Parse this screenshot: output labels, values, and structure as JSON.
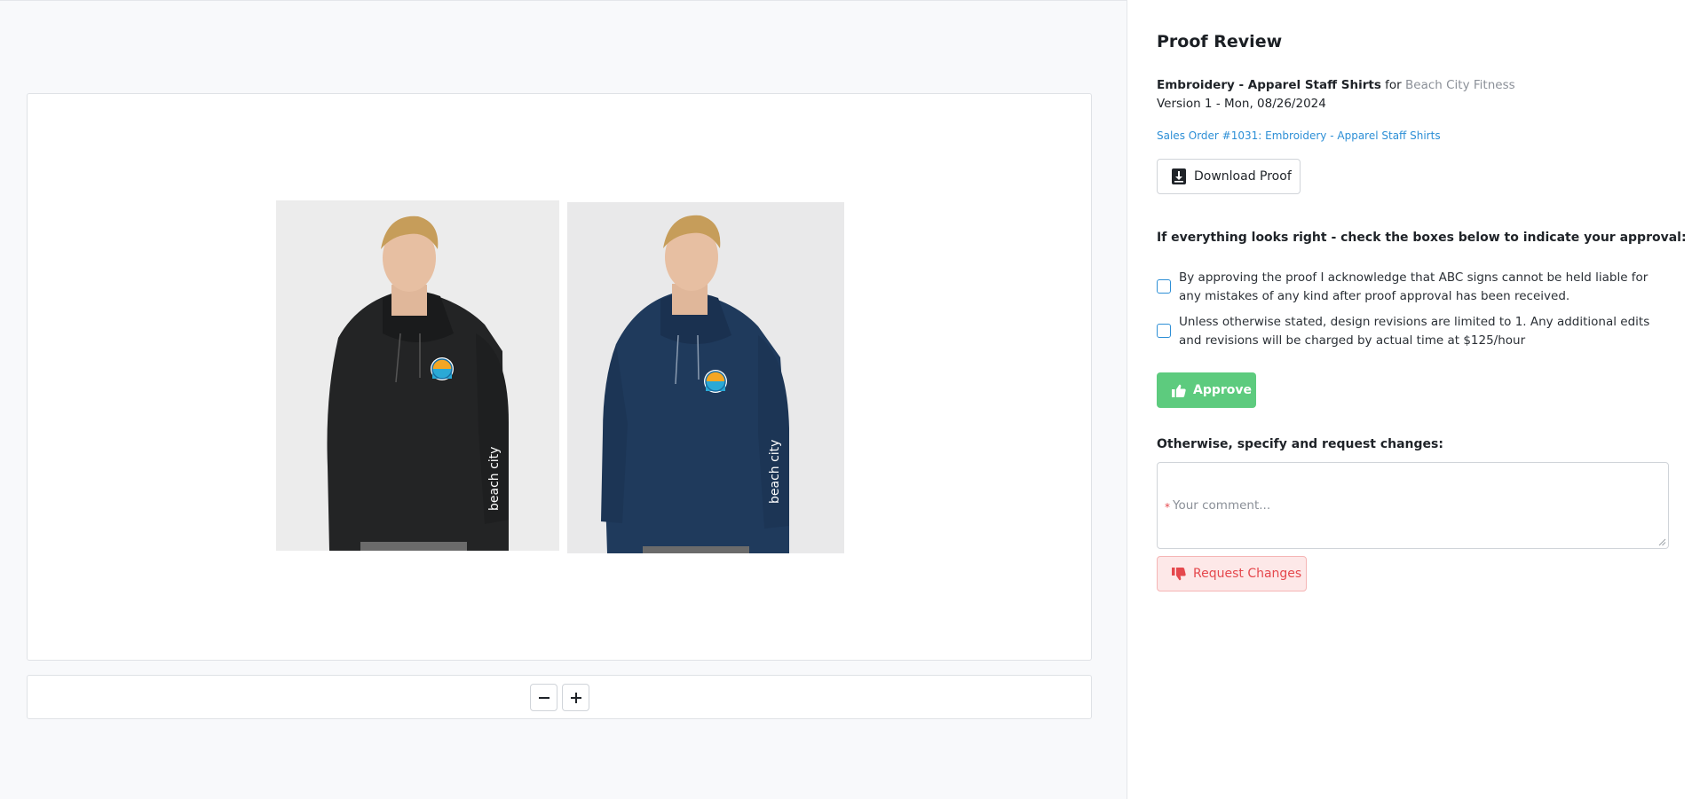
{
  "header": {
    "title": "Proof Review"
  },
  "job": {
    "name": "Embroidery - Apparel Staff Shirts",
    "for_word": "for",
    "client": "Beach City Fitness",
    "version": "Version 1 - Mon, 08/26/2024"
  },
  "sales_order": {
    "order_label": "Sales Order #1031",
    "separator": ":",
    "job_link": "Embroidery - Apparel Staff Shirts"
  },
  "download_button": {
    "label": "Download Proof",
    "icon": "download-icon"
  },
  "approval": {
    "heading": "If everything looks right - check the boxes below to indicate your approval:",
    "checkboxes": [
      {
        "label": "By approving the proof I acknowledge that ABC signs cannot be held liable for any mistakes of any kind after proof approval has been received.",
        "checked": false
      },
      {
        "label": "Unless otherwise stated, design revisions are limited to 1. Any additional edits and revisions will be charged by actual time at $125/hour",
        "checked": false
      }
    ],
    "approve_label": "Approve",
    "approve_icon": "thumbs-up-icon"
  },
  "changes": {
    "heading": "Otherwise, specify and request changes:",
    "required_marker": "*",
    "comment_placeholder": "Your comment...",
    "request_label": "Request Changes",
    "request_icon": "thumbs-down-icon"
  },
  "viewer": {
    "images": [
      {
        "description": "black-hoodie-mockup",
        "sleeve_text": "beach city"
      },
      {
        "description": "navy-hoodie-mockup",
        "sleeve_text": "beach city"
      }
    ],
    "zoom_out_icon": "minus-icon",
    "zoom_in_icon": "plus-icon"
  },
  "colors": {
    "accent": "#2d8fd6",
    "approve": "#5dcb7e",
    "danger": "#e5484d",
    "hoodie_black": "#232425",
    "hoodie_navy": "#1f3a5c"
  }
}
